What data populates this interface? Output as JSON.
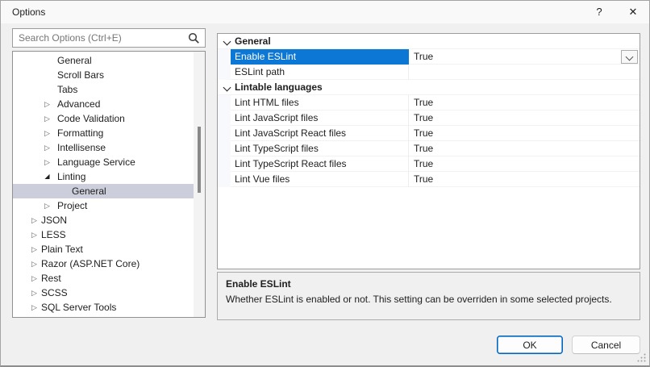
{
  "window": {
    "title": "Options",
    "help_label": "?",
    "close_label": "✕"
  },
  "search": {
    "placeholder": "Search Options (Ctrl+E)",
    "icon": "magnifier"
  },
  "tree": {
    "items": [
      {
        "label": "General",
        "level": 2,
        "state": "leaf"
      },
      {
        "label": "Scroll Bars",
        "level": 2,
        "state": "leaf"
      },
      {
        "label": "Tabs",
        "level": 2,
        "state": "leaf"
      },
      {
        "label": "Advanced",
        "level": 2,
        "state": "collapsed"
      },
      {
        "label": "Code Validation",
        "level": 2,
        "state": "collapsed"
      },
      {
        "label": "Formatting",
        "level": 2,
        "state": "collapsed"
      },
      {
        "label": "Intellisense",
        "level": 2,
        "state": "collapsed"
      },
      {
        "label": "Language Service",
        "level": 2,
        "state": "collapsed"
      },
      {
        "label": "Linting",
        "level": 2,
        "state": "expanded"
      },
      {
        "label": "General",
        "level": 3,
        "state": "leaf",
        "selected": true
      },
      {
        "label": "Project",
        "level": 2,
        "state": "collapsed"
      },
      {
        "label": "JSON",
        "level": 1,
        "state": "collapsed"
      },
      {
        "label": "LESS",
        "level": 1,
        "state": "collapsed"
      },
      {
        "label": "Plain Text",
        "level": 1,
        "state": "collapsed"
      },
      {
        "label": "Razor (ASP.NET Core)",
        "level": 1,
        "state": "collapsed"
      },
      {
        "label": "Rest",
        "level": 1,
        "state": "collapsed"
      },
      {
        "label": "SCSS",
        "level": 1,
        "state": "collapsed"
      },
      {
        "label": "SQL Server Tools",
        "level": 1,
        "state": "collapsed"
      }
    ]
  },
  "grid": {
    "sections": [
      {
        "header": "General",
        "rows": [
          {
            "name": "Enable ESLint",
            "value": "True",
            "selected": true,
            "has_dropdown": true
          },
          {
            "name": "ESLint path",
            "value": ""
          }
        ]
      },
      {
        "header": "Lintable languages",
        "rows": [
          {
            "name": "Lint HTML files",
            "value": "True"
          },
          {
            "name": "Lint JavaScript files",
            "value": "True"
          },
          {
            "name": "Lint JavaScript React files",
            "value": "True"
          },
          {
            "name": "Lint TypeScript files",
            "value": "True"
          },
          {
            "name": "Lint TypeScript React files",
            "value": "True"
          },
          {
            "name": "Lint Vue files",
            "value": "True"
          }
        ]
      }
    ]
  },
  "description": {
    "title": "Enable ESLint",
    "text": "Whether ESLint is enabled or not. This setting can be overriden in some selected projects."
  },
  "buttons": {
    "ok": "OK",
    "cancel": "Cancel"
  },
  "colors": {
    "accent": "#0c77d4",
    "tree_selection": "#cccedb"
  }
}
